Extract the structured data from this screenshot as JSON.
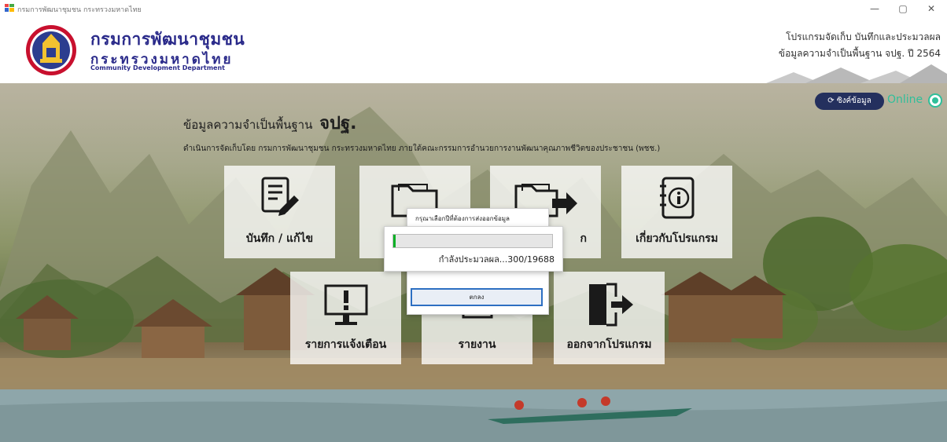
{
  "window": {
    "title": "กรมการพัฒนาชุมชน กระทรวงมหาดไทย",
    "controls": {
      "minimize": "—",
      "maximize": "▢",
      "close": "✕"
    }
  },
  "header": {
    "department_th": "กรมการพัฒนาชุมชน",
    "ministry_th": "กระทรวงมหาดไทย",
    "department_en": "Community Development Department",
    "program_line1": "โปรแกรมจัดเก็บ บันทึกและประมวลผล",
    "program_line2": "ข้อมูลความจำเป็นพื้นฐาน จปฐ. ปี 2564"
  },
  "main": {
    "title_prefix": "ข้อมูลความจำเป็นพื้นฐาน",
    "title_bold": "จปฐ.",
    "subtitle": "ดำเนินการจัดเก็บโดย กรมการพัฒนาชุมชน กระทรวงมหาดไทย ภายใต้คณะกรรมการอำนวยการงานพัฒนาคุณภาพชีวิตของประชาชน (พชช.)"
  },
  "sync": {
    "button_label": "ซิงค์ข้อมูล",
    "status_label": "Online"
  },
  "tiles": [
    {
      "label": "บันทึก / แก้ไข",
      "icon": "edit-document-icon"
    },
    {
      "label": "",
      "icon": "folder-icon"
    },
    {
      "label": "ก",
      "icon": "folder-export-icon"
    },
    {
      "label": "เกี่ยวกับโปรแกรม",
      "icon": "info-icon"
    },
    {
      "label": "รายการแจ้งเตือน",
      "icon": "alert-monitor-icon"
    },
    {
      "label": "รายงาน",
      "icon": "report-icon"
    },
    {
      "label": "ออกจากโปรแกรม",
      "icon": "exit-door-icon"
    }
  ],
  "dialog": {
    "title": "กรุณาเลือกปีที่ต้องการส่งออกข้อมูล",
    "ok_label": "ตกลง"
  },
  "progress": {
    "text": "กำลังประมวลผล...300/19688",
    "current": 300,
    "total": 19688,
    "color": "#06b025"
  },
  "colors": {
    "brand_blue": "#2a2a8a",
    "online_green": "#2fbf9a",
    "sync_button": "#24305e"
  }
}
